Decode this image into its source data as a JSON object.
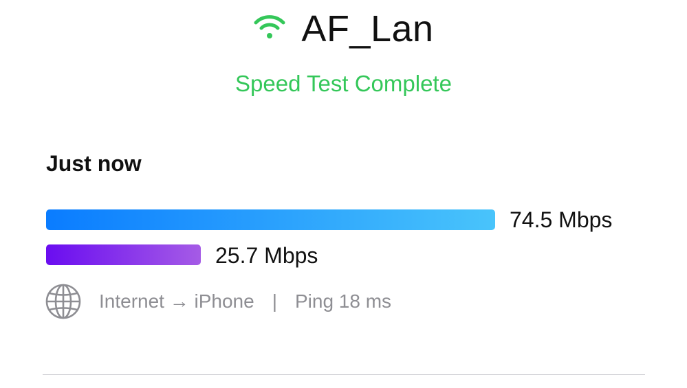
{
  "header": {
    "wifi_icon": "wifi-icon",
    "network_name": "AF_Lan"
  },
  "status": {
    "text": "Speed Test Complete",
    "color": "#34c759"
  },
  "result": {
    "time_label": "Just now",
    "download": {
      "value_mbps": 74.5,
      "label": "74.5 Mbps",
      "color_start": "#0a7cff",
      "color_end": "#49c4fb"
    },
    "upload": {
      "value_mbps": 25.7,
      "label": "25.7 Mbps",
      "color_start": "#6a0df0",
      "color_end": "#a55be6"
    },
    "bar_scale_max_mbps": 74.5,
    "info": {
      "icon": "globe-icon",
      "route": "Internet → iPhone",
      "separator": "|",
      "ping": "Ping 18 ms"
    }
  }
}
